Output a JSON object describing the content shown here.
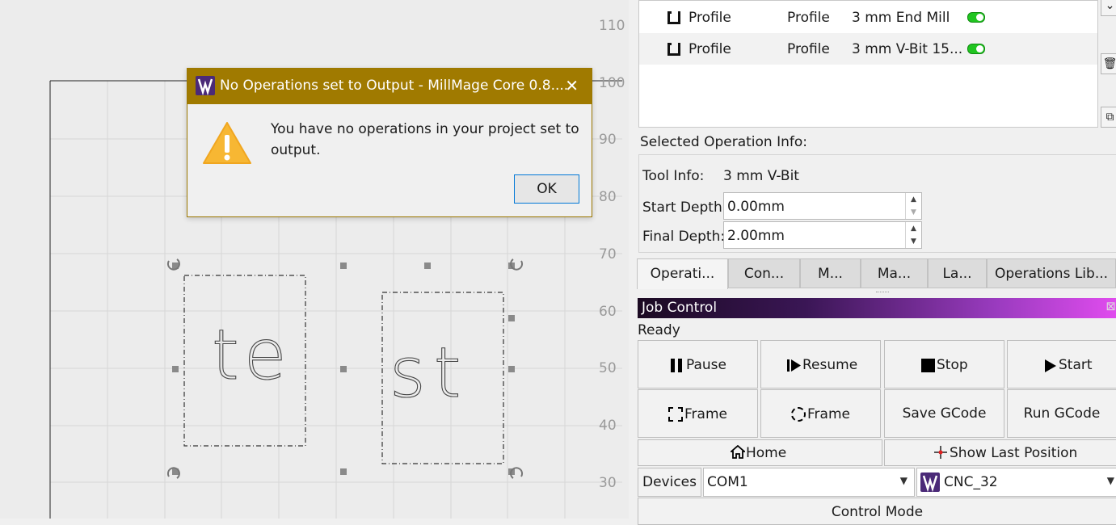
{
  "canvas": {
    "ruler": [
      "110",
      "100",
      "90",
      "80",
      "70",
      "60",
      "50",
      "40",
      "30"
    ],
    "text_left": "te",
    "text_right": "st"
  },
  "dialog": {
    "title": "No Operations set to Output - MillMage Core 0.8....",
    "close_glyph": "✕",
    "message": "You have no operations in your project set to output.",
    "ok_label": "OK"
  },
  "operations": [
    {
      "name": "Profile",
      "type": "Profile",
      "tool": "3 mm End Mill",
      "enabled": true
    },
    {
      "name": "Profile",
      "type": "Profile",
      "tool": "3 mm V-Bit 15...",
      "enabled": true
    }
  ],
  "selected_info": {
    "heading": "Selected Operation Info:",
    "tool_label": "Tool Info:",
    "tool_value": "3 mm V-Bit",
    "start_label": "Start Depth:",
    "start_value": "0.00mm",
    "final_label": "Final Depth:",
    "final_value": "2.00mm"
  },
  "tabs": [
    "Operati...",
    "Con...",
    "M...",
    "Ma...",
    "La...",
    "Operations Lib..."
  ],
  "job_control": {
    "title": "Job Control",
    "status": "Ready",
    "buttons": {
      "pause": "Pause",
      "resume": "Resume",
      "stop": "Stop",
      "start": "Start",
      "frame_rect": "Frame",
      "frame_circle": "Frame",
      "save_gcode": "Save GCode",
      "run_gcode": "Run GCode",
      "home": "Home",
      "show_last": "Show Last Position"
    },
    "devices_label": "Devices",
    "port": "COM1",
    "device": "CNC_32",
    "control_mode": "Control Mode"
  }
}
